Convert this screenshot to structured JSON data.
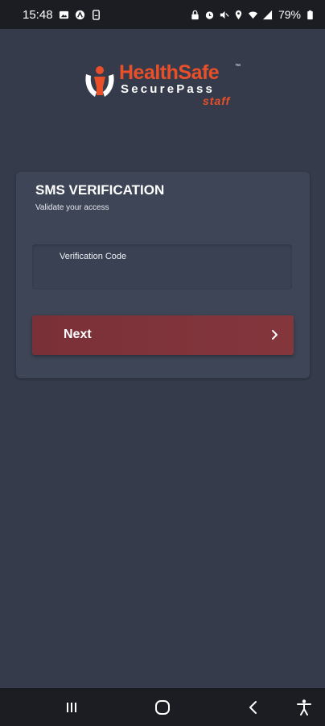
{
  "status_bar": {
    "time": "15:48",
    "battery": "79%",
    "left_icons": [
      "image-icon",
      "accessibility-circle-icon",
      "sim-icon"
    ],
    "right_icons": [
      "lock-icon",
      "alarm-icon",
      "mute-icon",
      "location-icon",
      "wifi-icon",
      "signal-icon",
      "battery-icon"
    ]
  },
  "logo": {
    "name": "HealthSafe",
    "tm": "™",
    "subtitle": "SecurePass",
    "tag": "staff",
    "accent_color": "#e9502a"
  },
  "card": {
    "title": "SMS VERIFICATION",
    "subtitle": "Validate your access",
    "field": {
      "label": "Verification Code",
      "value": ""
    },
    "next_button": {
      "label": "Next",
      "color": "#7a3037"
    }
  },
  "nav_bar": {
    "icons": [
      "recent-apps-icon",
      "home-icon",
      "back-icon",
      "accessibility-icon"
    ]
  },
  "colors": {
    "background": "#353b4b",
    "card": "#3e4556"
  }
}
